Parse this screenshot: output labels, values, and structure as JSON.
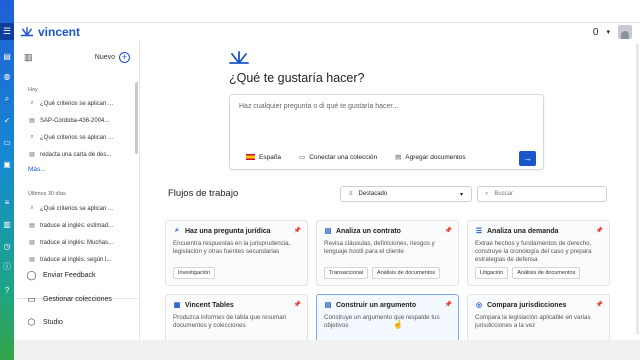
{
  "app": {
    "name": "vincent",
    "notification_count": "0",
    "accent": "#1a56c9"
  },
  "sidebar": {
    "new_label": "Nuevo",
    "sections": [
      {
        "label": "Hoy",
        "items": [
          {
            "icon": "search-icon",
            "label": "¿Qué criterios se aplican ..."
          },
          {
            "icon": "document-icon",
            "label": "SAP-Cordoba-436-2004..."
          },
          {
            "icon": "search-icon",
            "label": "¿Qué criterios se aplican ..."
          },
          {
            "icon": "document-icon",
            "label": "redacta una carta de des..."
          }
        ]
      },
      {
        "label": "Últimos 30 días",
        "items": [
          {
            "icon": "search-icon",
            "label": "¿Qué criterios se aplican ..."
          },
          {
            "icon": "document-icon",
            "label": "traduce al inglés: estimad..."
          },
          {
            "icon": "document-icon",
            "label": "traduce al inglés: Muchas..."
          },
          {
            "icon": "document-icon",
            "label": "traduce al inglés: según l..."
          }
        ]
      }
    ],
    "more_label": "Más...",
    "links": [
      {
        "icon": "chat-bubble-icon",
        "label": "Enviar Feedback"
      },
      {
        "icon": "folder-icon",
        "label": "Gestionar colecciones"
      },
      {
        "icon": "cube-icon",
        "label": "Studio"
      }
    ]
  },
  "main": {
    "title": "¿Qué te gustaría hacer?",
    "prompt": {
      "placeholder": "Haz cualquier pregunta o di qué te gustaría hacer...",
      "country": "España",
      "connect_label": "Conectar una colección",
      "add_docs_label": "Agregar documentos"
    },
    "workflows": {
      "title": "Flujos de trabajo",
      "filter_value": "Destacado",
      "search_placeholder": "Buscar",
      "cards": [
        {
          "icon": "search-icon",
          "title": "Haz una pregunta jurídica",
          "desc": "Encuentra respuestas en la jurisprudencia, legislación y otras fuentes secundarias",
          "tags": [
            "Investigación"
          ]
        },
        {
          "icon": "document-icon",
          "title": "Analiza un contrato",
          "desc": "Revisa cláusulas, definiciones, riesgos y lenguaje hostil para el cliente",
          "tags": [
            "Transaccional",
            "Análisis de documentos"
          ]
        },
        {
          "icon": "list-icon",
          "title": "Analiza una demanda",
          "desc": "Extrae hechos y fundamentos de derecho, construye la cronología del caso y prepara estrategias de defensa",
          "tags": [
            "Litigación",
            "Análisis de documentos"
          ]
        },
        {
          "icon": "table-icon",
          "title": "Vincent Tables",
          "desc": "Produzca informes de tabla que resuman documentos y colecciones",
          "tags": []
        },
        {
          "icon": "document-icon",
          "title": "Construir un argumento",
          "desc": "Construye un argumento que respalde tus objetivos",
          "tags": []
        },
        {
          "icon": "globe-icon",
          "title": "Compara jurisdicciones",
          "desc": "Compara la legislación aplicable en varias jurisdicciones a la vez",
          "tags": []
        }
      ]
    }
  }
}
